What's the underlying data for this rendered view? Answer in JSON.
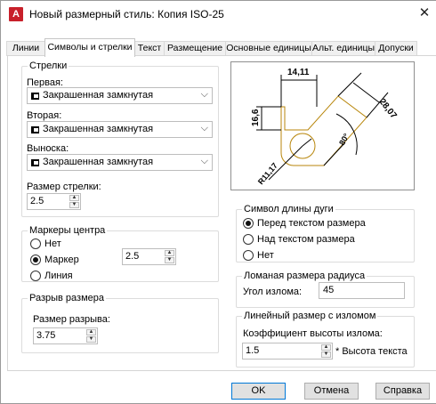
{
  "window": {
    "title": "Новый размерный стиль: Копия ISO-25",
    "app_icon_letter": "A",
    "close_glyph": "✕"
  },
  "tabs": [
    {
      "label": "Линии"
    },
    {
      "label": "Символы и стрелки"
    },
    {
      "label": "Текст"
    },
    {
      "label": "Размещение"
    },
    {
      "label": "Основные единицы"
    },
    {
      "label": "Альт. единицы"
    },
    {
      "label": "Допуски"
    }
  ],
  "arrows": {
    "title": "Стрелки",
    "first_label": "Первая:",
    "first_value": "Закрашенная замкнутая",
    "second_label": "Вторая:",
    "second_value": "Закрашенная замкнутая",
    "leader_label": "Выноска:",
    "leader_value": "Закрашенная замкнутая",
    "size_label": "Размер стрелки:",
    "size_value": "2.5"
  },
  "center_marks": {
    "title": "Маркеры центра",
    "none_label": "Нет",
    "mark_label": "Маркер",
    "line_label": "Линия",
    "selected": "mark",
    "size_value": "2.5"
  },
  "dim_break": {
    "title": "Разрыв размера",
    "size_label": "Размер разрыва:",
    "size_value": "3.75"
  },
  "arc_symbol": {
    "title": "Символ длины дуги",
    "before_label": "Перед текстом размера",
    "above_label": "Над текстом размера",
    "none_label": "Нет",
    "selected": "before"
  },
  "radius_jog": {
    "title": "Ломаная размера радиуса",
    "angle_label": "Угол излома:",
    "angle_value": "45"
  },
  "linear_jog": {
    "title": "Линейный размер с изломом",
    "factor_label": "Коэффициент высоты излома:",
    "factor_value": "1.5",
    "suffix_label": "* Высота текста"
  },
  "preview": {
    "dim_top": "14,11",
    "dim_left": "16,6",
    "dim_diag": "28,07",
    "dim_angle": "80°",
    "dim_radius": "R11,17",
    "geometry_color": "#b8860b"
  },
  "buttons": {
    "ok": "OK",
    "cancel": "Отмена",
    "help": "Справка"
  },
  "colors": {
    "accent": "#0078d7",
    "icon_red": "#c8202a"
  }
}
